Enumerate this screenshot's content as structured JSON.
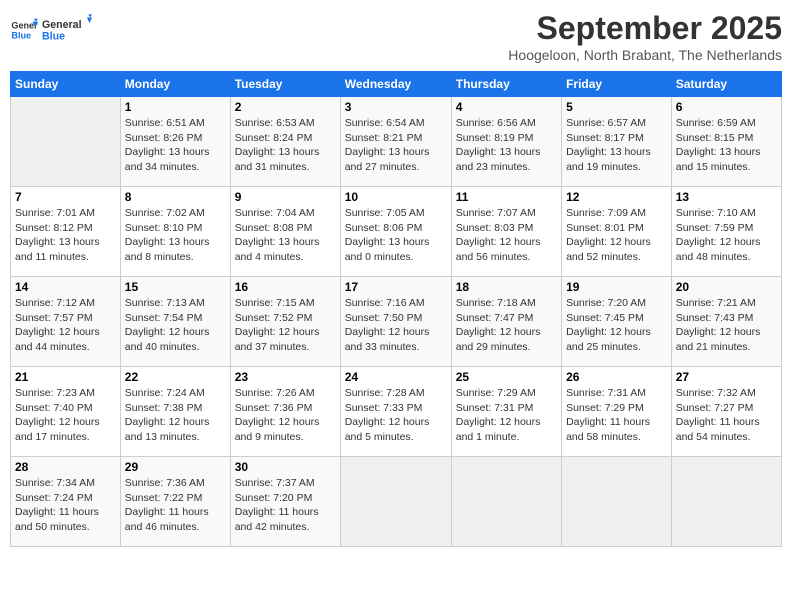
{
  "header": {
    "logo_line1": "General",
    "logo_line2": "Blue",
    "month": "September 2025",
    "location": "Hoogeloon, North Brabant, The Netherlands"
  },
  "days_of_week": [
    "Sunday",
    "Monday",
    "Tuesday",
    "Wednesday",
    "Thursday",
    "Friday",
    "Saturday"
  ],
  "weeks": [
    [
      {
        "day": "",
        "info": ""
      },
      {
        "day": "1",
        "info": "Sunrise: 6:51 AM\nSunset: 8:26 PM\nDaylight: 13 hours\nand 34 minutes."
      },
      {
        "day": "2",
        "info": "Sunrise: 6:53 AM\nSunset: 8:24 PM\nDaylight: 13 hours\nand 31 minutes."
      },
      {
        "day": "3",
        "info": "Sunrise: 6:54 AM\nSunset: 8:21 PM\nDaylight: 13 hours\nand 27 minutes."
      },
      {
        "day": "4",
        "info": "Sunrise: 6:56 AM\nSunset: 8:19 PM\nDaylight: 13 hours\nand 23 minutes."
      },
      {
        "day": "5",
        "info": "Sunrise: 6:57 AM\nSunset: 8:17 PM\nDaylight: 13 hours\nand 19 minutes."
      },
      {
        "day": "6",
        "info": "Sunrise: 6:59 AM\nSunset: 8:15 PM\nDaylight: 13 hours\nand 15 minutes."
      }
    ],
    [
      {
        "day": "7",
        "info": "Sunrise: 7:01 AM\nSunset: 8:12 PM\nDaylight: 13 hours\nand 11 minutes."
      },
      {
        "day": "8",
        "info": "Sunrise: 7:02 AM\nSunset: 8:10 PM\nDaylight: 13 hours\nand 8 minutes."
      },
      {
        "day": "9",
        "info": "Sunrise: 7:04 AM\nSunset: 8:08 PM\nDaylight: 13 hours\nand 4 minutes."
      },
      {
        "day": "10",
        "info": "Sunrise: 7:05 AM\nSunset: 8:06 PM\nDaylight: 13 hours\nand 0 minutes."
      },
      {
        "day": "11",
        "info": "Sunrise: 7:07 AM\nSunset: 8:03 PM\nDaylight: 12 hours\nand 56 minutes."
      },
      {
        "day": "12",
        "info": "Sunrise: 7:09 AM\nSunset: 8:01 PM\nDaylight: 12 hours\nand 52 minutes."
      },
      {
        "day": "13",
        "info": "Sunrise: 7:10 AM\nSunset: 7:59 PM\nDaylight: 12 hours\nand 48 minutes."
      }
    ],
    [
      {
        "day": "14",
        "info": "Sunrise: 7:12 AM\nSunset: 7:57 PM\nDaylight: 12 hours\nand 44 minutes."
      },
      {
        "day": "15",
        "info": "Sunrise: 7:13 AM\nSunset: 7:54 PM\nDaylight: 12 hours\nand 40 minutes."
      },
      {
        "day": "16",
        "info": "Sunrise: 7:15 AM\nSunset: 7:52 PM\nDaylight: 12 hours\nand 37 minutes."
      },
      {
        "day": "17",
        "info": "Sunrise: 7:16 AM\nSunset: 7:50 PM\nDaylight: 12 hours\nand 33 minutes."
      },
      {
        "day": "18",
        "info": "Sunrise: 7:18 AM\nSunset: 7:47 PM\nDaylight: 12 hours\nand 29 minutes."
      },
      {
        "day": "19",
        "info": "Sunrise: 7:20 AM\nSunset: 7:45 PM\nDaylight: 12 hours\nand 25 minutes."
      },
      {
        "day": "20",
        "info": "Sunrise: 7:21 AM\nSunset: 7:43 PM\nDaylight: 12 hours\nand 21 minutes."
      }
    ],
    [
      {
        "day": "21",
        "info": "Sunrise: 7:23 AM\nSunset: 7:40 PM\nDaylight: 12 hours\nand 17 minutes."
      },
      {
        "day": "22",
        "info": "Sunrise: 7:24 AM\nSunset: 7:38 PM\nDaylight: 12 hours\nand 13 minutes."
      },
      {
        "day": "23",
        "info": "Sunrise: 7:26 AM\nSunset: 7:36 PM\nDaylight: 12 hours\nand 9 minutes."
      },
      {
        "day": "24",
        "info": "Sunrise: 7:28 AM\nSunset: 7:33 PM\nDaylight: 12 hours\nand 5 minutes."
      },
      {
        "day": "25",
        "info": "Sunrise: 7:29 AM\nSunset: 7:31 PM\nDaylight: 12 hours\nand 1 minute."
      },
      {
        "day": "26",
        "info": "Sunrise: 7:31 AM\nSunset: 7:29 PM\nDaylight: 11 hours\nand 58 minutes."
      },
      {
        "day": "27",
        "info": "Sunrise: 7:32 AM\nSunset: 7:27 PM\nDaylight: 11 hours\nand 54 minutes."
      }
    ],
    [
      {
        "day": "28",
        "info": "Sunrise: 7:34 AM\nSunset: 7:24 PM\nDaylight: 11 hours\nand 50 minutes."
      },
      {
        "day": "29",
        "info": "Sunrise: 7:36 AM\nSunset: 7:22 PM\nDaylight: 11 hours\nand 46 minutes."
      },
      {
        "day": "30",
        "info": "Sunrise: 7:37 AM\nSunset: 7:20 PM\nDaylight: 11 hours\nand 42 minutes."
      },
      {
        "day": "",
        "info": ""
      },
      {
        "day": "",
        "info": ""
      },
      {
        "day": "",
        "info": ""
      },
      {
        "day": "",
        "info": ""
      }
    ]
  ]
}
